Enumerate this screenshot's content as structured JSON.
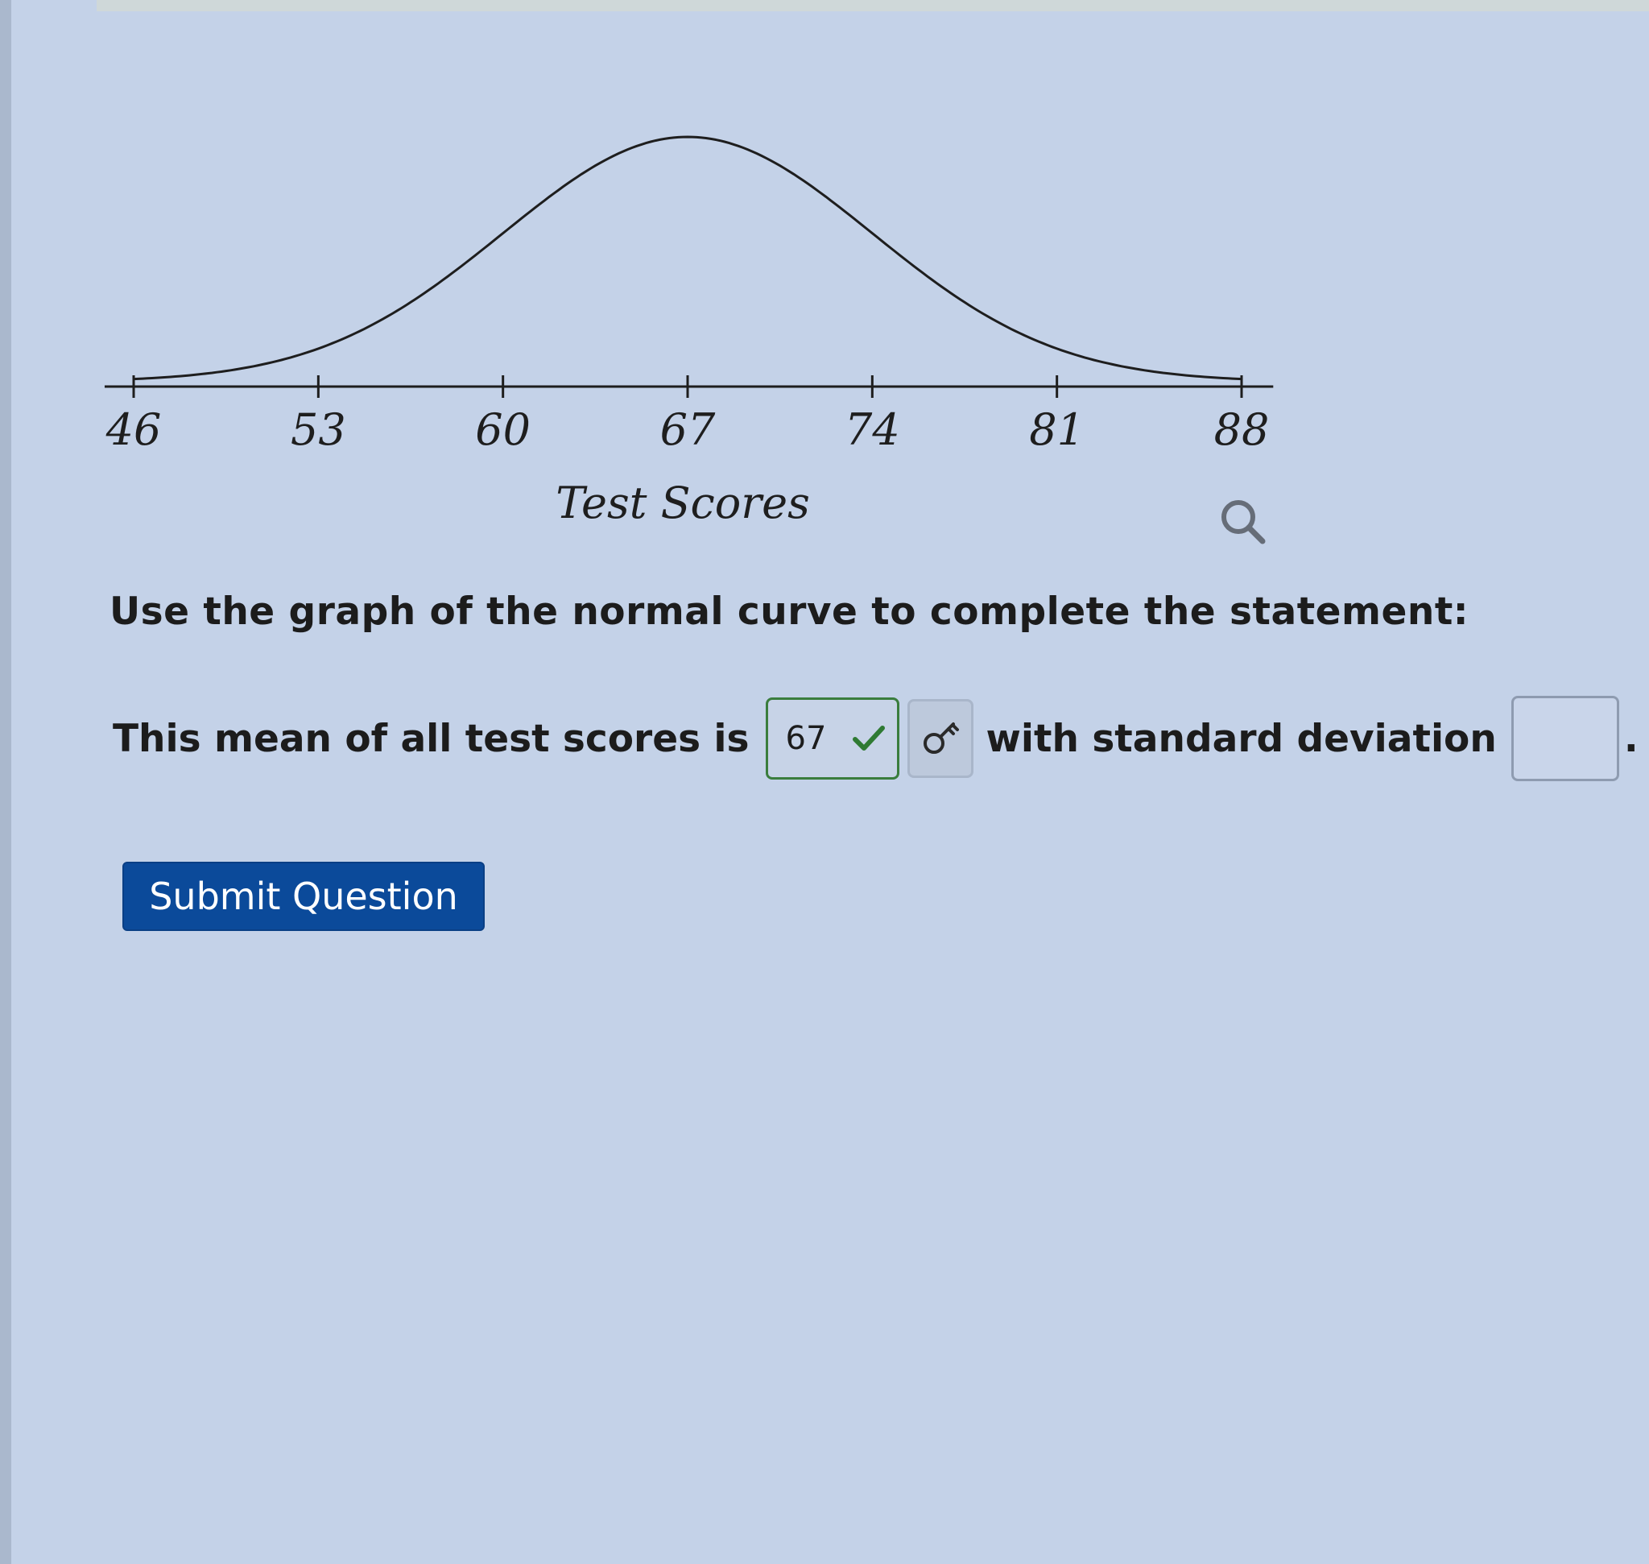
{
  "chart_data": {
    "type": "line",
    "title": "",
    "xlabel": "Test Scores",
    "ylabel": "",
    "tick_labels": [
      "46",
      "53",
      "60",
      "67",
      "74",
      "81",
      "88"
    ],
    "x_ticks": [
      46,
      53,
      60,
      67,
      74,
      81,
      88
    ],
    "xlim": [
      44.9,
      89.2
    ],
    "curve": "normal distribution",
    "mean": 67,
    "std_dev": 7,
    "grid": false,
    "legend": "none"
  },
  "question": {
    "prompt": "Use the graph of the normal curve to complete the statement:",
    "statement_before": "This mean of all test scores is",
    "mean_answer": "67",
    "mean_answer_status": "correct",
    "statement_middle": "with standard deviation",
    "sd_answer": "",
    "statement_end": "."
  },
  "icons": {
    "zoom": "magnifier-icon",
    "check": "checkmark-icon",
    "hint": "key-icon"
  },
  "colors": {
    "background": "#c4d2e8",
    "correct": "#2f7a33",
    "submit": "#0b4a9a"
  },
  "submit_label": "Submit Question"
}
